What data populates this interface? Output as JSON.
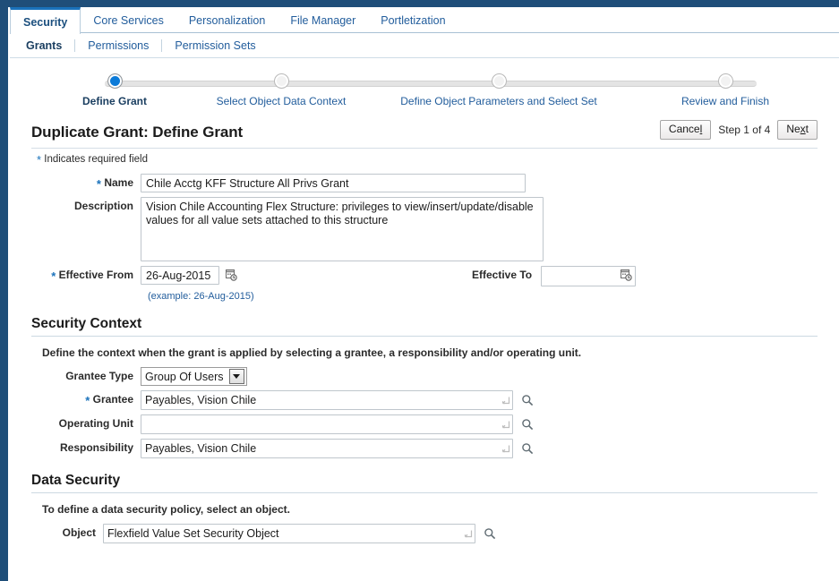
{
  "theme": {
    "chrome_navy": "#1f4e79",
    "accent_blue": "#1a72bb",
    "link_blue": "#225d9c",
    "step_done": "#0b7ad8"
  },
  "tabs": [
    {
      "label": "Security",
      "active": true
    },
    {
      "label": "Core Services",
      "active": false
    },
    {
      "label": "Personalization",
      "active": false
    },
    {
      "label": "File Manager",
      "active": false
    },
    {
      "label": "Portletization",
      "active": false
    }
  ],
  "subtabs": [
    {
      "label": "Grants",
      "active": true
    },
    {
      "label": "Permissions",
      "active": false
    },
    {
      "label": "Permission Sets",
      "active": false
    }
  ],
  "train": {
    "steps": [
      {
        "label": "Define Grant",
        "state": "current"
      },
      {
        "label": "Select Object Data Context",
        "state": "pending"
      },
      {
        "label": "Define Object Parameters and Select Set",
        "state": "pending"
      },
      {
        "label": "Review and Finish",
        "state": "pending"
      }
    ]
  },
  "header": {
    "title": "Duplicate Grant: Define Grant",
    "cancel_label": "Cancel",
    "cancel_pre": "Cance",
    "cancel_key": "l",
    "next_pre": "Ne",
    "next_key": "x",
    "next_post": "t",
    "next_label": "Next",
    "step_counter": "Step 1 of 4",
    "required_note": "Indicates required field"
  },
  "define_grant": {
    "name_label": "Name",
    "name_value": "Chile Acctg KFF Structure All Privs Grant",
    "name_placeholder": "",
    "description_label": "Description",
    "description_value": "Vision Chile Accounting Flex Structure: privileges to view/insert/update/disable values for all value sets attached to this structure",
    "description_placeholder": "",
    "effective_from_label": "Effective From",
    "effective_from_value": "26-Aug-2015",
    "effective_from_example": "(example: 26-Aug-2015)",
    "effective_to_label": "Effective To",
    "effective_to_value": "",
    "effective_to_placeholder": ""
  },
  "security_context": {
    "title": "Security Context",
    "description": "Define the context when the grant is applied by selecting a grantee, a responsibility and/or operating unit.",
    "grantee_type_label": "Grantee Type",
    "grantee_type_value": "Group Of Users",
    "grantee_type_options": [
      "Group Of Users"
    ],
    "grantee_label": "Grantee",
    "grantee_value": "Payables, Vision Chile",
    "operating_unit_label": "Operating Unit",
    "operating_unit_value": "",
    "responsibility_label": "Responsibility",
    "responsibility_value": "Payables, Vision Chile"
  },
  "data_security": {
    "title": "Data Security",
    "description": "To define a data security policy, select an object.",
    "object_label": "Object",
    "object_value": "Flexfield Value Set Security Object"
  },
  "icons": {
    "calendar": "calendar-icon",
    "search": "search-icon",
    "lov_arrow": "lov-arrow-icon",
    "dropdown_caret": "chevron-down-icon"
  }
}
